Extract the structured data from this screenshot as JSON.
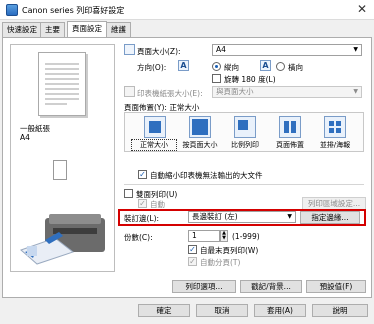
{
  "window": {
    "title": "Canon        series 列印喜好設定",
    "close_glyph": "✕"
  },
  "tabs": [
    {
      "label": "快速設定",
      "active": false
    },
    {
      "label": "主要",
      "active": false
    },
    {
      "label": "頁面設定",
      "active": true
    },
    {
      "label": "維護",
      "active": false
    }
  ],
  "preview": {
    "paper_label": "一般紙張",
    "paper_size": "A4"
  },
  "page_size": {
    "label": "頁面大小(Z):",
    "value": "A4"
  },
  "orientation": {
    "label": "方向(O):",
    "portrait_label": "縱向",
    "landscape_label": "橫向",
    "selected": "portrait",
    "rotate_label": "旋轉 180 度(L)"
  },
  "printer_paper_size": {
    "label": "印表機紙張大小(E):",
    "value": "與頁面大小"
  },
  "page_layout": {
    "label": "頁面佈置(Y): 正常大小",
    "options": [
      "正常大小",
      "按頁面大小",
      "比例列印",
      "頁面佈置",
      "並排/海報"
    ],
    "selected_index": 0
  },
  "auto_reduce": {
    "label": "自動縮小印表機無法輸出的大文件",
    "checked": true
  },
  "duplex": {
    "label": "雙面列印(U)",
    "checked": false,
    "auto_label": "自動",
    "auto_checked": true,
    "print_area_button": "列印區域設定..."
  },
  "stapling": {
    "label": "裝訂邊(L):",
    "value": "長邊裝訂 (左)",
    "margin_button": "指定邊緣..."
  },
  "copies": {
    "label": "份數(C):",
    "value": "1",
    "range": "(1-999)",
    "last_page_first_label": "自最末頁列印(W)",
    "last_page_first_checked": true,
    "collate_label": "自動分頁(T)",
    "collate_checked": true
  },
  "options_row": {
    "print_options": "列印選項...",
    "stamp_background": "戳記/背景...",
    "defaults": "預設值(F)"
  },
  "footer": {
    "ok": "確定",
    "cancel": "取消",
    "apply": "套用(A)",
    "help": "說明"
  },
  "colors": {
    "highlight": "#d40000",
    "accent": "#1a5fb4"
  }
}
